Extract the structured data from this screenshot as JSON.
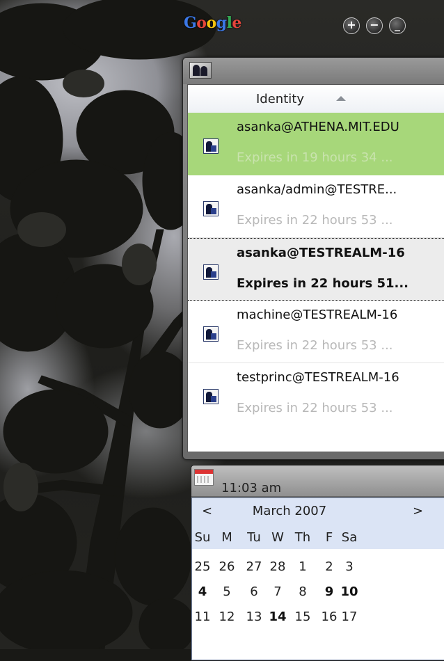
{
  "header": {
    "logo_letters": [
      "G",
      "o",
      "o",
      "g",
      "l",
      "e"
    ],
    "buttons": [
      "+",
      "−",
      "_"
    ]
  },
  "identities": {
    "column_header": "Identity",
    "items": [
      {
        "name": "asanka@ATHENA.MIT.EDU",
        "expiry": "Expires in 19 hours 34 ...",
        "state": "selected"
      },
      {
        "name": "asanka/admin@TESTRE...",
        "expiry": "Expires in 22 hours 53 ...",
        "state": "normal"
      },
      {
        "name": "asanka@TESTREALM-16",
        "expiry": "Expires in 22 hours 51...",
        "state": "focused"
      },
      {
        "name": "machine@TESTREALM-16",
        "expiry": "Expires in 22 hours 53 ...",
        "state": "normal"
      },
      {
        "name": "testprinc@TESTREALM-16",
        "expiry": "Expires in 22 hours 53 ...",
        "state": "normal"
      }
    ]
  },
  "clock": {
    "time": "11:03 am"
  },
  "calendar": {
    "prev": "<",
    "next": ">",
    "month": "March 2007",
    "weekdays": [
      "Su",
      "M",
      "Tu",
      "W",
      "Th",
      "F",
      "Sa"
    ],
    "weeks": [
      [
        "25",
        "26",
        "27",
        "28",
        "1",
        "2",
        "3"
      ],
      [
        "4",
        "5",
        "6",
        "7",
        "8",
        "9",
        "10"
      ],
      [
        "11",
        "12",
        "13",
        "14",
        "15",
        "16",
        "17"
      ]
    ],
    "bold_days": [
      "4",
      "9",
      "10",
      "14"
    ]
  },
  "colors": {
    "selected_row": "#a7d77a",
    "calendar_header": "#dbe4f5"
  }
}
